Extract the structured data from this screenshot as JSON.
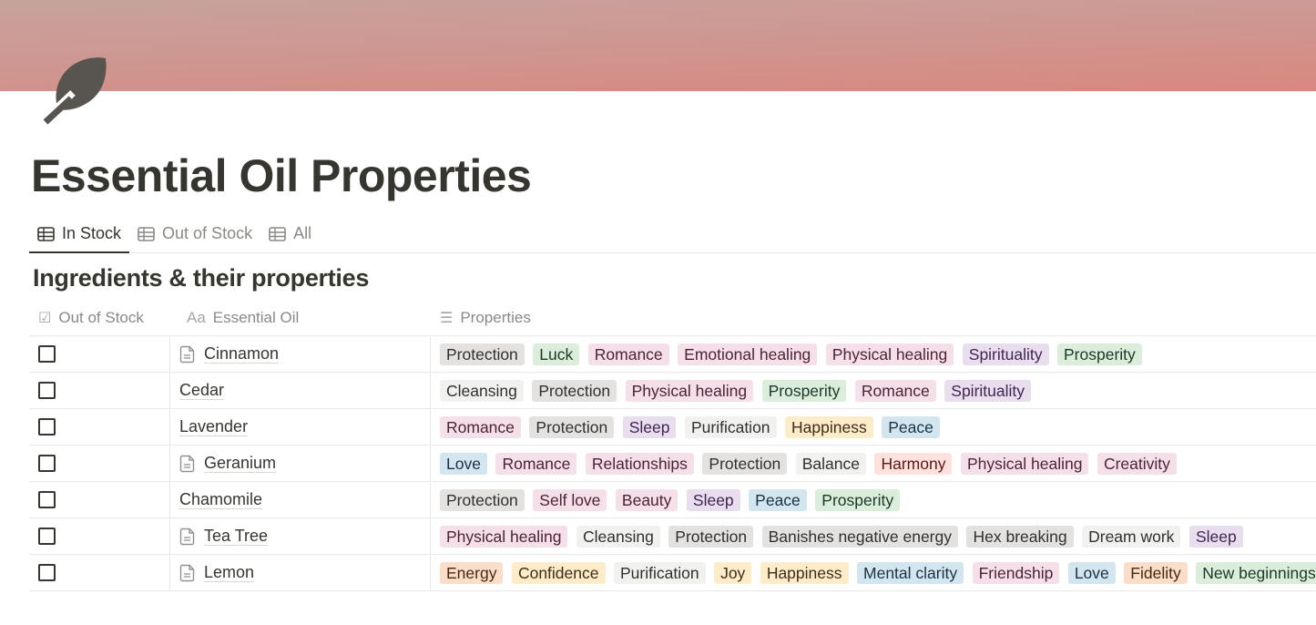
{
  "page": {
    "title": "Essential Oil Properties",
    "icon": "leaf-icon",
    "cover_colors": [
      "#c6a39c",
      "#d8877f"
    ]
  },
  "tabs": [
    {
      "label": "In Stock",
      "icon": "table-icon",
      "active": true
    },
    {
      "label": "Out of Stock",
      "icon": "table-icon",
      "active": false
    },
    {
      "label": "All",
      "icon": "table-icon",
      "active": false
    }
  ],
  "database": {
    "title": "Ingredients & their properties",
    "columns": [
      {
        "label": "Out of Stock",
        "icon": "checkbox-icon",
        "icon_glyph": "☑"
      },
      {
        "label": "Essential Oil",
        "icon": "text-aa-icon",
        "icon_glyph": "Aa"
      },
      {
        "label": "Properties",
        "icon": "list-icon",
        "icon_glyph": "☰"
      }
    ],
    "rows": [
      {
        "name": "Cinnamon",
        "has_doc": true,
        "checked": false,
        "tags": [
          {
            "label": "Protection",
            "color": "gray"
          },
          {
            "label": "Luck",
            "color": "green"
          },
          {
            "label": "Romance",
            "color": "pink"
          },
          {
            "label": "Emotional healing",
            "color": "pink"
          },
          {
            "label": "Physical healing",
            "color": "pink"
          },
          {
            "label": "Spirituality",
            "color": "purple"
          },
          {
            "label": "Prosperity",
            "color": "green"
          }
        ]
      },
      {
        "name": "Cedar",
        "has_doc": false,
        "checked": false,
        "tags": [
          {
            "label": "Cleansing",
            "color": "default"
          },
          {
            "label": "Protection",
            "color": "gray"
          },
          {
            "label": "Physical healing",
            "color": "pink"
          },
          {
            "label": "Prosperity",
            "color": "green"
          },
          {
            "label": "Romance",
            "color": "pink"
          },
          {
            "label": "Spirituality",
            "color": "purple"
          }
        ]
      },
      {
        "name": "Lavender",
        "has_doc": false,
        "checked": false,
        "tags": [
          {
            "label": "Romance",
            "color": "pink"
          },
          {
            "label": "Protection",
            "color": "gray"
          },
          {
            "label": "Sleep",
            "color": "purple"
          },
          {
            "label": "Purification",
            "color": "default"
          },
          {
            "label": "Happiness",
            "color": "yellow"
          },
          {
            "label": "Peace",
            "color": "blue"
          }
        ]
      },
      {
        "name": "Geranium",
        "has_doc": true,
        "checked": false,
        "tags": [
          {
            "label": "Love",
            "color": "blue"
          },
          {
            "label": "Romance",
            "color": "pink"
          },
          {
            "label": "Relationships",
            "color": "pink"
          },
          {
            "label": "Protection",
            "color": "gray"
          },
          {
            "label": "Balance",
            "color": "default"
          },
          {
            "label": "Harmony",
            "color": "red"
          },
          {
            "label": "Physical healing",
            "color": "pink"
          },
          {
            "label": "Creativity",
            "color": "pink"
          }
        ]
      },
      {
        "name": "Chamomile",
        "has_doc": false,
        "checked": false,
        "tags": [
          {
            "label": "Protection",
            "color": "gray"
          },
          {
            "label": "Self love",
            "color": "pink"
          },
          {
            "label": "Beauty",
            "color": "pink"
          },
          {
            "label": "Sleep",
            "color": "purple"
          },
          {
            "label": "Peace",
            "color": "blue"
          },
          {
            "label": "Prosperity",
            "color": "green"
          }
        ]
      },
      {
        "name": "Tea Tree",
        "has_doc": true,
        "checked": false,
        "tags": [
          {
            "label": "Physical healing",
            "color": "pink"
          },
          {
            "label": "Cleansing",
            "color": "default"
          },
          {
            "label": "Protection",
            "color": "gray"
          },
          {
            "label": "Banishes negative energy",
            "color": "gray"
          },
          {
            "label": "Hex breaking",
            "color": "gray"
          },
          {
            "label": "Dream work",
            "color": "default"
          },
          {
            "label": "Sleep",
            "color": "purple"
          }
        ]
      },
      {
        "name": "Lemon",
        "has_doc": true,
        "checked": false,
        "tags": [
          {
            "label": "Energy",
            "color": "orange"
          },
          {
            "label": "Confidence",
            "color": "yellow"
          },
          {
            "label": "Purification",
            "color": "default"
          },
          {
            "label": "Joy",
            "color": "yellow"
          },
          {
            "label": "Happiness",
            "color": "yellow"
          },
          {
            "label": "Mental clarity",
            "color": "blue"
          },
          {
            "label": "Friendship",
            "color": "pink"
          },
          {
            "label": "Love",
            "color": "blue"
          },
          {
            "label": "Fidelity",
            "color": "orange"
          },
          {
            "label": "New beginnings",
            "color": "green"
          }
        ]
      }
    ]
  }
}
